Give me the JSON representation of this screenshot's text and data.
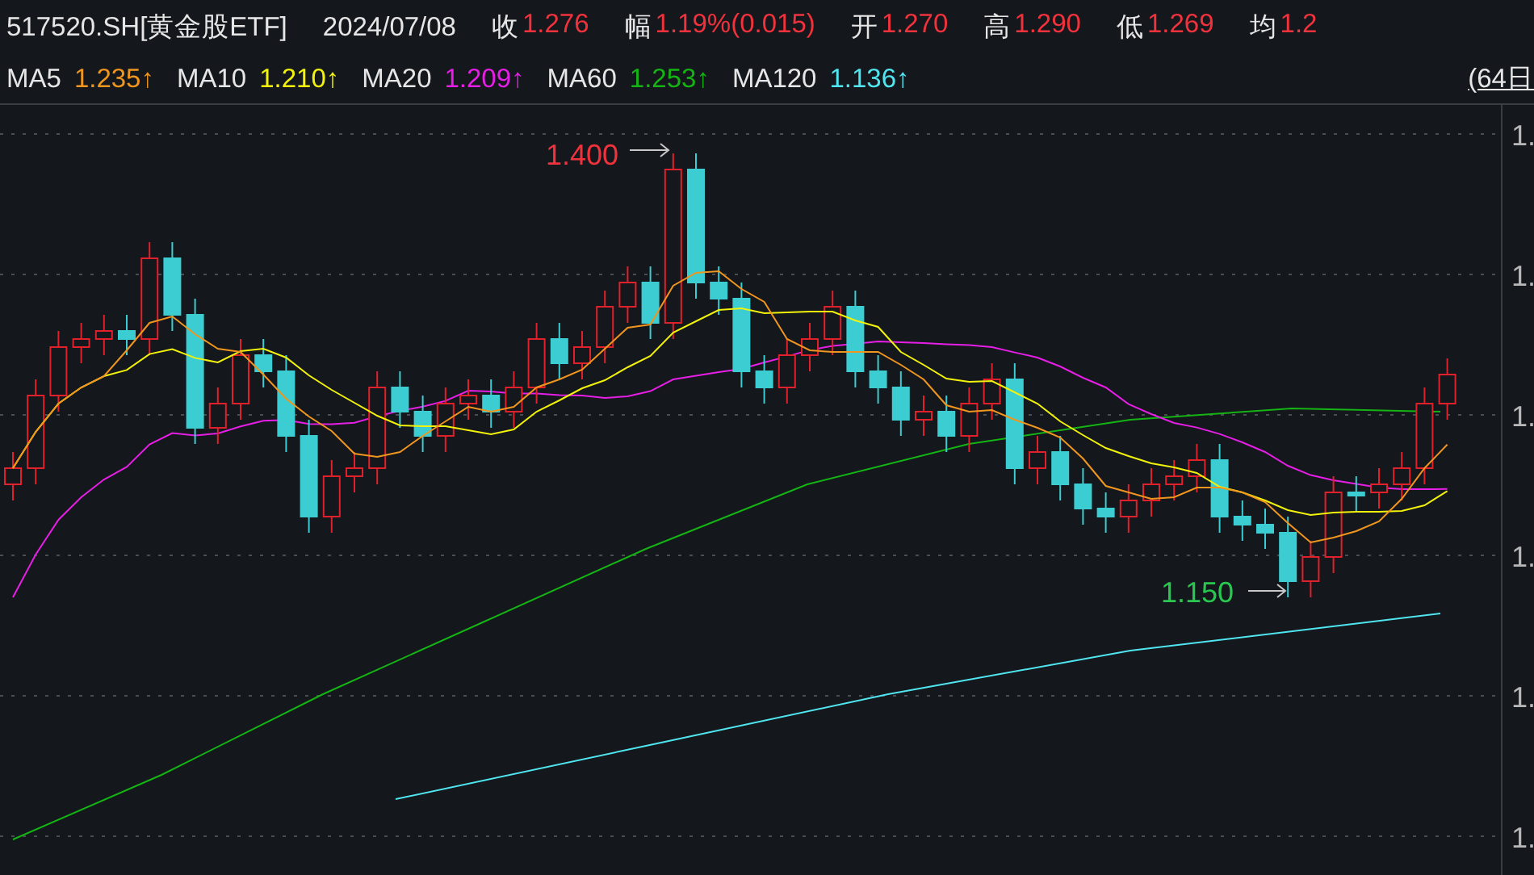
{
  "header": {
    "symbol": "517520.SH[黄金股ETF]",
    "date": "2024/07/08",
    "quotes": [
      {
        "label": "收",
        "value": "1.276"
      },
      {
        "label": "幅",
        "value": "1.19%(0.015)"
      },
      {
        "label": "开",
        "value": "1.270"
      },
      {
        "label": "高",
        "value": "1.290"
      },
      {
        "label": "低",
        "value": "1.269"
      },
      {
        "label": "均",
        "value": "1.2"
      }
    ]
  },
  "ma_legend": [
    {
      "label": "MA5",
      "value": "1.235↑",
      "color": "#f0961e"
    },
    {
      "label": "MA10",
      "value": "1.210↑",
      "color": "#f2f20a"
    },
    {
      "label": "MA20",
      "value": "1.209↑",
      "color": "#e61ee6"
    },
    {
      "label": "MA60",
      "value": "1.253↑",
      "color": "#14b414"
    },
    {
      "label": "MA120",
      "value": "1.136↑",
      "color": "#50e6f0"
    }
  ],
  "period_label": "(64日",
  "chart": {
    "high_label": "1.400",
    "low_label": "1.150",
    "axis_labels": [
      "1.",
      "1.",
      "1.",
      "1.",
      "1.",
      "1."
    ]
  }
}
